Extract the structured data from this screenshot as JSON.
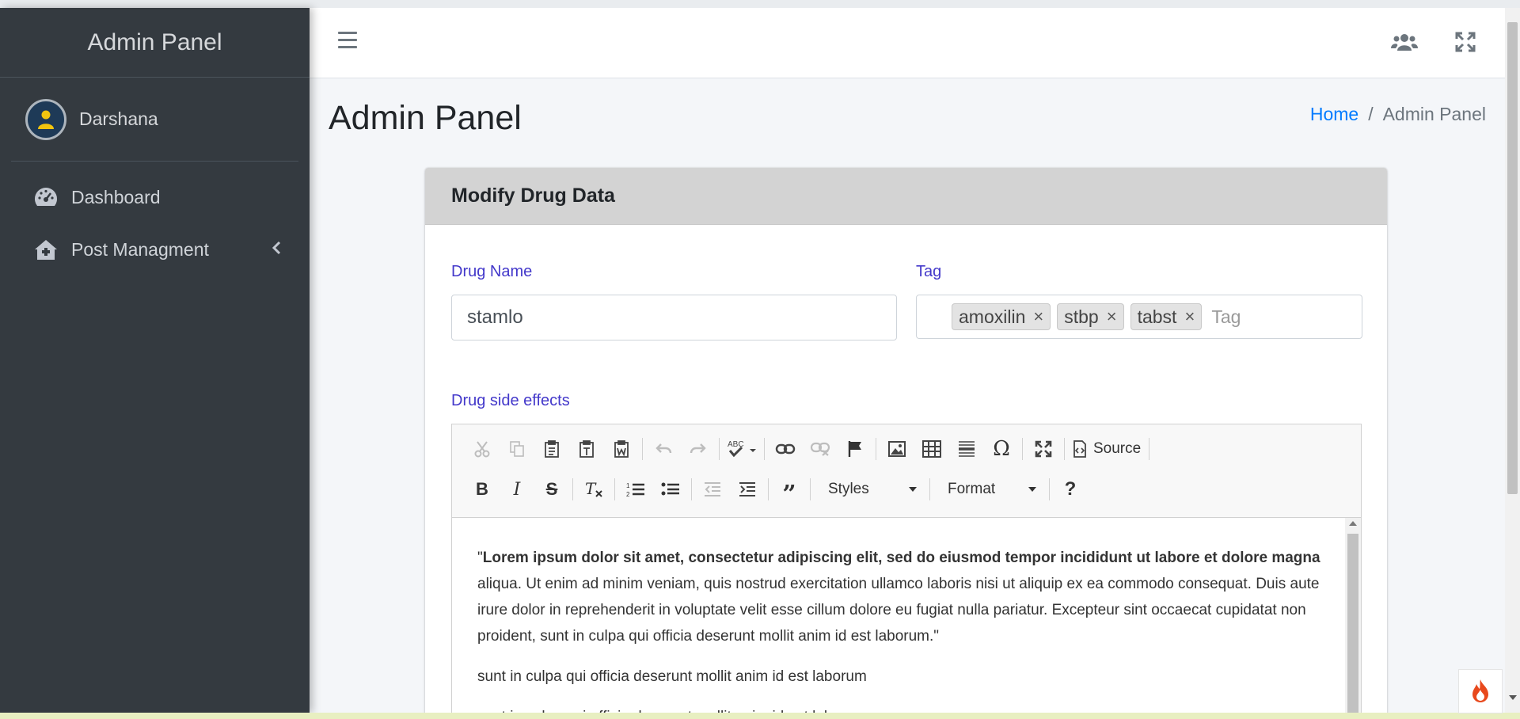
{
  "sidebar": {
    "brand": "Admin Panel",
    "user_name": "Darshana",
    "items": [
      {
        "label": "Dashboard",
        "icon": "tachometer-icon"
      },
      {
        "label": "Post Managment",
        "icon": "home-icon",
        "expand_icon": "chevron-left-icon"
      }
    ]
  },
  "topbar": {
    "menu_icon": "hamburger-icon",
    "right_icons": [
      "users-icon",
      "fullscreen-icon"
    ]
  },
  "header": {
    "title": "Admin Panel",
    "breadcrumb": {
      "home": "Home",
      "separator": "/",
      "current": "Admin Panel"
    }
  },
  "card": {
    "title": "Modify Drug Data",
    "drug_name_label": "Drug Name",
    "drug_name_value": "stamlo",
    "tag_label": "Tag",
    "tags": [
      "amoxilin",
      "stbp",
      "tabst"
    ],
    "tag_placeholder": "Tag",
    "side_effects_label": "Drug side effects"
  },
  "editor": {
    "source_label": "Source",
    "styles_label": "Styles",
    "format_label": "Format",
    "help_label": "?",
    "paragraph1_bold": "Lorem ipsum dolor sit amet, consectetur adipiscing elit, sed do eiusmod tempor incididunt ut labore et dolore magna",
    "paragraph1_rest": " aliqua. Ut enim ad minim veniam, quis nostrud exercitation ullamco laboris nisi ut aliquip ex ea commodo consequat. Duis aute irure dolor in reprehenderit in voluptate velit esse cillum dolore eu fugiat nulla pariatur. Excepteur sint occaecat cupidatat non proident, sunt in culpa qui officia deserunt mollit anim id est laborum.\"",
    "paragraph1_quote": "\"",
    "paragraph2": "sunt in culpa qui officia deserunt mollit anim id est laborum",
    "paragraph3": "sunt in culpa qui officia deserunt mollit anim id est laborum"
  },
  "colors": {
    "sidebar_bg": "#343a40",
    "label_color": "#4338ca",
    "link_color": "#007bff",
    "card_header_bg": "#d3d3d3"
  }
}
